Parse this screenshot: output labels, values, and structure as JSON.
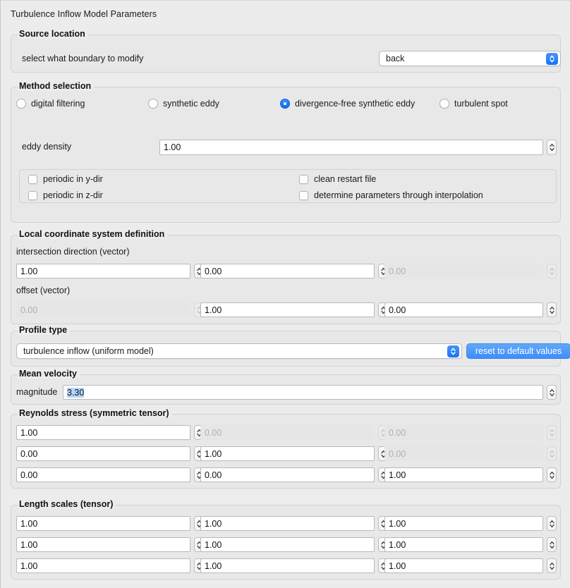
{
  "window": {
    "title": "Turbulence Inflow Model Parameters"
  },
  "source_location": {
    "legend": "Source location",
    "boundary_label": "select what boundary to modify",
    "boundary_value": "back",
    "dropdown_icon": "chevron-up-down-icon"
  },
  "method_selection": {
    "legend": "Method selection",
    "options": [
      {
        "label": "digital filtering",
        "selected": false
      },
      {
        "label": "synthetic eddy",
        "selected": false
      },
      {
        "label": "divergence-free synthetic eddy",
        "selected": true
      },
      {
        "label": "turbulent spot",
        "selected": false
      }
    ],
    "eddy_density_label": "eddy density",
    "eddy_density_value": "1.00",
    "checkboxes": [
      {
        "label": "periodic in y-dir",
        "checked": false
      },
      {
        "label": "periodic in z-dir",
        "checked": false
      },
      {
        "label": "clean restart file",
        "checked": false
      },
      {
        "label": "determine parameters through interpolation",
        "checked": false
      }
    ]
  },
  "local_coordinate": {
    "legend": "Local coordinate system definition",
    "intersection_label": "intersection direction (vector)",
    "intersection": [
      {
        "value": "1.00",
        "disabled": false
      },
      {
        "value": "0.00",
        "disabled": false
      },
      {
        "value": "0.00",
        "disabled": true
      }
    ],
    "offset_label": "offset (vector)",
    "offset": [
      {
        "value": "0.00",
        "disabled": true
      },
      {
        "value": "1.00",
        "disabled": false
      },
      {
        "value": "0.00",
        "disabled": false
      }
    ]
  },
  "profile_type": {
    "legend": "Profile type",
    "value": "turbulence inflow (uniform model)",
    "reset_button": "reset to default values",
    "dropdown_icon": "chevron-up-down-icon"
  },
  "mean_velocity": {
    "legend": "Mean velocity",
    "magnitude_label": "magnitude",
    "magnitude_value": "3.30",
    "magnitude_selected": true
  },
  "reynolds_stress": {
    "legend": "Reynolds stress (symmetric tensor)",
    "rows": [
      [
        {
          "value": "1.00",
          "disabled": false
        },
        {
          "value": "0.00",
          "disabled": true
        },
        {
          "value": "0.00",
          "disabled": true
        }
      ],
      [
        {
          "value": "0.00",
          "disabled": false
        },
        {
          "value": "1.00",
          "disabled": false
        },
        {
          "value": "0.00",
          "disabled": true
        }
      ],
      [
        {
          "value": "0.00",
          "disabled": false
        },
        {
          "value": "0.00",
          "disabled": false
        },
        {
          "value": "1.00",
          "disabled": false
        }
      ]
    ]
  },
  "length_scales": {
    "legend": "Length scales (tensor)",
    "rows": [
      [
        {
          "value": "1.00",
          "disabled": false
        },
        {
          "value": "1.00",
          "disabled": false
        },
        {
          "value": "1.00",
          "disabled": false
        }
      ],
      [
        {
          "value": "1.00",
          "disabled": false
        },
        {
          "value": "1.00",
          "disabled": false
        },
        {
          "value": "1.00",
          "disabled": false
        }
      ],
      [
        {
          "value": "1.00",
          "disabled": false
        },
        {
          "value": "1.00",
          "disabled": false
        },
        {
          "value": "1.00",
          "disabled": false
        }
      ]
    ]
  },
  "colors": {
    "accent_blue": "#2c7ef8",
    "window_bg": "#ececec",
    "group_bg": "#e8e8e8",
    "selection_blue": "#b4d5fe"
  }
}
